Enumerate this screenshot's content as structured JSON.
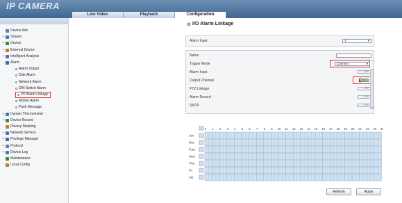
{
  "app": {
    "logo": "IP CAMERA"
  },
  "tabs": [
    {
      "label": "Live Video"
    },
    {
      "label": "Playback"
    },
    {
      "label": "Configuration"
    }
  ],
  "sidebar": {
    "items": [
      {
        "label": "Device Info",
        "exp": "",
        "level": 0
      },
      {
        "label": "Stream",
        "exp": "+",
        "level": 0
      },
      {
        "label": "Device",
        "exp": "+",
        "level": 0
      },
      {
        "label": "External Device",
        "exp": "+",
        "level": 0
      },
      {
        "label": "Intelligent Analysis",
        "exp": "+",
        "level": 0
      },
      {
        "label": "Alarm",
        "exp": "−",
        "level": 0
      },
      {
        "label": "Alarm Output",
        "exp": "",
        "level": 1
      },
      {
        "label": "Disk Alarm",
        "exp": "",
        "level": 1
      },
      {
        "label": "Network Alarm",
        "exp": "",
        "level": 1
      },
      {
        "label": "D/N Switch Alarm",
        "exp": "",
        "level": 1
      },
      {
        "label": "I/O Alarm Linkage",
        "exp": "",
        "level": 1
      },
      {
        "label": "Motion Alarm",
        "exp": "",
        "level": 1
      },
      {
        "label": "Push Message",
        "exp": "",
        "level": 1
      },
      {
        "label": "Human Thermometer",
        "exp": "+",
        "level": 0
      },
      {
        "label": "Device Record",
        "exp": "+",
        "level": 0
      },
      {
        "label": "Privacy Masking",
        "exp": "",
        "level": 0
      },
      {
        "label": "Network Service",
        "exp": "+",
        "level": 0
      },
      {
        "label": "Privilege Manager",
        "exp": "+",
        "level": 0
      },
      {
        "label": "Protocol",
        "exp": "+",
        "level": 0
      },
      {
        "label": "Device Log",
        "exp": "+",
        "level": 0
      },
      {
        "label": "Maintenance",
        "exp": "",
        "level": 0
      },
      {
        "label": "Local Config",
        "exp": "",
        "level": 0
      }
    ]
  },
  "page": {
    "title": "I/O Alarm Linkage",
    "alarm_input_label": "Alarm Input",
    "alarm_input_value": "1"
  },
  "settings": {
    "name_label": "Name",
    "name_value": "",
    "trigger_mode_label": "Trigger Mode",
    "trigger_mode_value": "Connect",
    "alarm_input_label": "Alarm Input",
    "alarm_input_toggle": "OFF",
    "output_channel_label": "Output Channel",
    "ptz_linkage_label": "PTZ Linkage",
    "ptz_linkage_toggle": "OFF",
    "alarm_record_label": "Alarm Record",
    "alarm_record_toggle": "OFF",
    "smtp_label": "SMTP",
    "smtp_toggle": "OFF"
  },
  "schedule": {
    "days": [
      "Sun",
      "Mon",
      "Tues",
      "Wed",
      "Thur",
      "Fri",
      "Sat"
    ],
    "hours": [
      "0",
      "1",
      "2",
      "3",
      "4",
      "5",
      "6",
      "7",
      "8",
      "9",
      "10",
      "11",
      "12",
      "13",
      "14",
      "15",
      "16",
      "17",
      "18",
      "19",
      "20",
      "21",
      "22",
      "23",
      "24"
    ]
  },
  "buttons": {
    "refresh": "Refresh",
    "apply": "Apply"
  },
  "colors": {
    "header_top": "#6f90b6",
    "header_bottom": "#3f6791",
    "grid_fill": "#cfe0ef",
    "grid_line": "#8fb0cf",
    "highlight": "#d9343a"
  }
}
